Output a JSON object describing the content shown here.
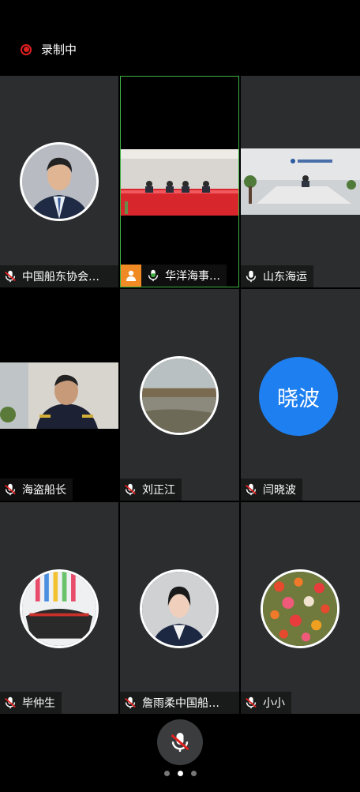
{
  "status": {
    "recording_label": "录制中"
  },
  "participants": [
    {
      "name": "中国船东协会…",
      "mic": "muted"
    },
    {
      "name": "华洋海事…",
      "mic": "on",
      "host": true
    },
    {
      "name": "山东海运",
      "mic": "on"
    },
    {
      "name": "海盗船长",
      "mic": "muted"
    },
    {
      "name": "刘正江",
      "mic": "muted"
    },
    {
      "name": "闫晓波",
      "mic": "muted",
      "initials": "晓波"
    },
    {
      "name": "毕仲生",
      "mic": "muted"
    },
    {
      "name": "詹雨柔中国船…",
      "mic": "muted"
    },
    {
      "name": "小小",
      "mic": "muted"
    }
  ],
  "pager": {
    "pages": 3,
    "current": 2
  },
  "colors": {
    "active_border": "#3cb043",
    "host_badge": "#f08a24",
    "initials_bg": "#1e7ff0",
    "muted_red": "#e02020"
  }
}
